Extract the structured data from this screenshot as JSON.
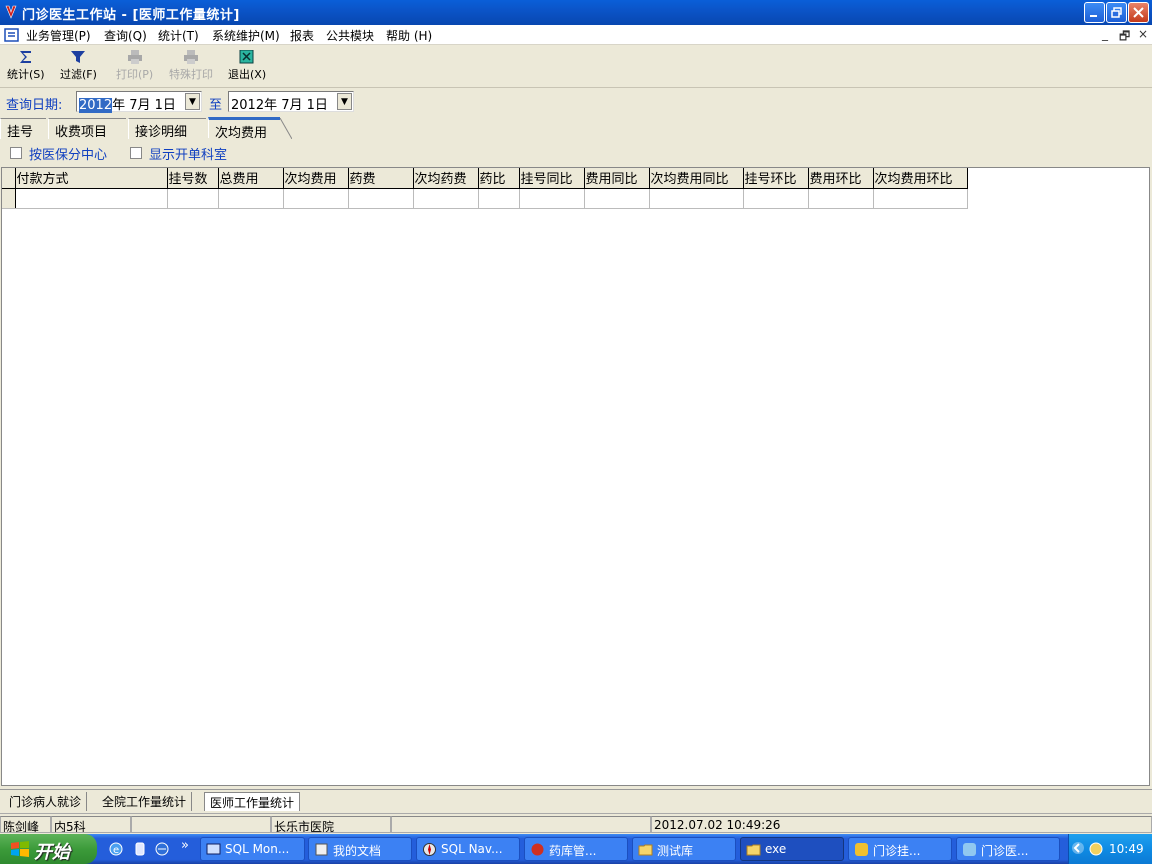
{
  "window": {
    "title": "门诊医生工作站 - [医师工作量统计]"
  },
  "menu": {
    "items": [
      "业务管理(P)",
      "查询(Q)",
      "统计(T)",
      "系统维护(M)",
      "报表",
      "公共模块",
      "帮助 (H)"
    ],
    "mdi_controls": [
      "_",
      "🗗",
      "×"
    ]
  },
  "toolbar": {
    "stats": "统计(S)",
    "filter": "过滤(F)",
    "print": "打印(P)",
    "special_print": "特殊打印",
    "exit": "退出(X)"
  },
  "query": {
    "label": "查询日期:",
    "from_year": "2012",
    "from_rest": "年  7月  1日",
    "to_label": "至",
    "to_date": "2012年  7月  1日"
  },
  "tabs": [
    "挂号",
    "收费项目",
    "接诊明细",
    "次均费用"
  ],
  "options": {
    "by_center": "按医保分中心",
    "show_dept": "显示开单科室"
  },
  "grid": {
    "columns": [
      "付款方式",
      "挂号数",
      "总费用",
      "次均费用",
      "药费",
      "次均药费",
      "药比",
      "挂号同比",
      "费用同比",
      "次均费用同比",
      "挂号环比",
      "费用环比",
      "次均费用环比"
    ]
  },
  "mdi_tabs": [
    "门诊病人就诊",
    "全院工作量统计",
    "医师工作量统计"
  ],
  "status": {
    "user": "陈剑峰",
    "dept": "内5科",
    "empty1": "",
    "hospital": "长乐市医院",
    "empty2": "",
    "datetime": "2012.07.02 10:49:26"
  },
  "taskbar": {
    "start": "开始",
    "overflow": "»",
    "tasks": [
      "SQL Mon...",
      "我的文档",
      "SQL Nav...",
      "药库管...",
      "测试库",
      "exe",
      "门诊挂...",
      "门诊医..."
    ],
    "clock": "10:49"
  },
  "colors": {
    "titlebar": "#0b54c8",
    "label_blue": "#1040c0",
    "taskbar": "#245edb",
    "start_green": "#3c9b3a"
  }
}
